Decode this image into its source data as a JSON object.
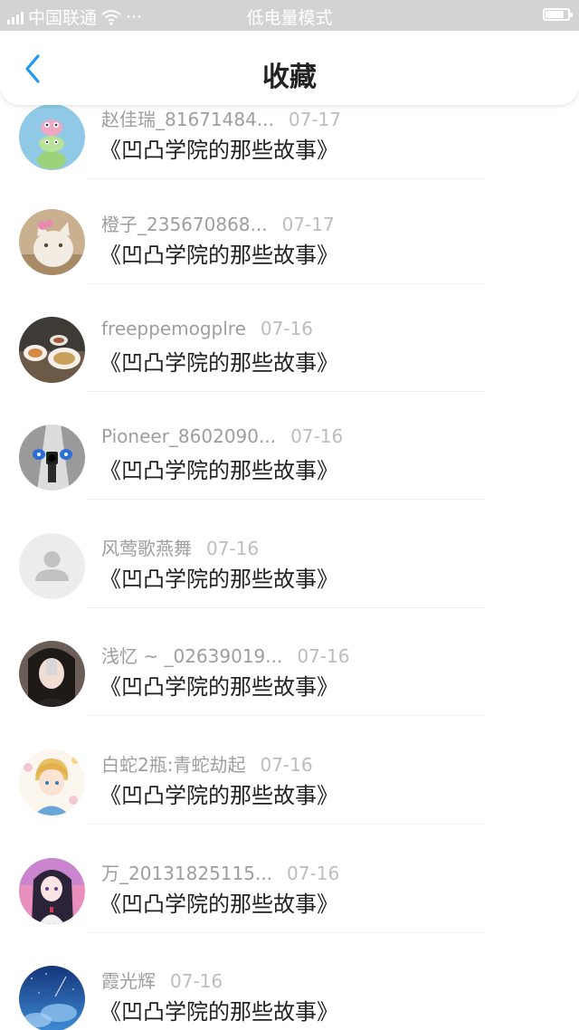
{
  "status_bar": {
    "carrier": "中国联通",
    "dots": "···",
    "mode": "低电量模式",
    "battery_level": 0.9
  },
  "nav": {
    "title": "收藏",
    "back_icon": "chevron-left-icon"
  },
  "colors": {
    "accent": "#2196f3",
    "status_bar_bg": "#d3d3d3",
    "meta_text": "#9e9e9e",
    "title_text": "#222222"
  },
  "items": [
    {
      "user": "赵佳瑞_81671484...",
      "date": "07-17",
      "title": "《凹凸学院的那些故事》",
      "avatar": "stacked-frogs-avatar"
    },
    {
      "user": "橙子_235670868...",
      "date": "07-17",
      "title": "《凹凸学院的那些故事》",
      "avatar": "cat-photo-avatar"
    },
    {
      "user": "freeppemogplre",
      "date": "07-16",
      "title": "《凹凸学院的那些故事》",
      "avatar": "food-plates-avatar"
    },
    {
      "user": "Pioneer_8602090...",
      "date": "07-16",
      "title": "《凹凸学院的那些故事》",
      "avatar": "anime-gun-avatar"
    },
    {
      "user": "风莺歌燕舞",
      "date": "07-16",
      "title": "《凹凸学院的那些故事》",
      "avatar": "default-user-avatar"
    },
    {
      "user": "浅忆 ~ _02639019...",
      "date": "07-16",
      "title": "《凹凸学院的那些故事》",
      "avatar": "girl-selfie-avatar"
    },
    {
      "user": "白蛇2瓶:青蛇劫起",
      "date": "07-16",
      "title": "《凹凸学院的那些故事》",
      "avatar": "anime-boy-avatar"
    },
    {
      "user": "万_20131825115...",
      "date": "07-16",
      "title": "《凹凸学院的那些故事》",
      "avatar": "anime-girl-avatar"
    },
    {
      "user": "霞光辉",
      "date": "07-16",
      "title": "《凹凸学院的那些故事》",
      "avatar": "blue-sky-avatar"
    }
  ]
}
